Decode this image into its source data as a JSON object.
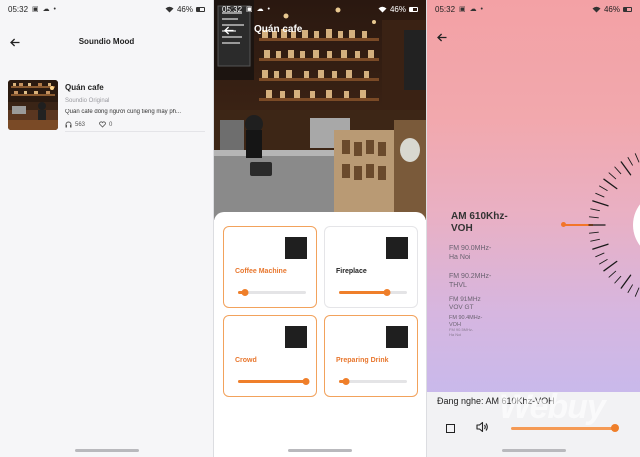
{
  "status_bar": {
    "time": "05:32",
    "left_icons": "▣ ☁ •",
    "battery": "46%"
  },
  "screen_list": {
    "title": "Soundio Mood",
    "item": {
      "title": "Quán cafe",
      "subtitle": "Soundio Original",
      "description": "Quán cafe đông người cùng tiếng máy ph...",
      "plays": "563",
      "likes": "0"
    }
  },
  "screen_mixer": {
    "title": "Quán cafe",
    "sounds": [
      {
        "label": "Coffee Machine",
        "level": 0.1,
        "active": true
      },
      {
        "label": "Fireplace",
        "level": 0.7,
        "active": false
      },
      {
        "label": "Crowd",
        "level": 1.0,
        "active": true
      },
      {
        "label": "Preparing Drink",
        "level": 0.1,
        "active": true
      }
    ]
  },
  "screen_radio": {
    "current_station": "AM 610Khz-\nVOH",
    "stations": [
      "FM  90.0MHz-\nHa Noi",
      "FM  90.2MHz-\nTHVL",
      "FM  91MHz\nVOV GT",
      "FM  90.4MHz-\nVOH",
      "FM  90.5MHz-\nHa Noi"
    ],
    "now_playing": "Đang nghe: AM 610Khz-VOH",
    "volume": 1.0,
    "watermark": "Webuy"
  },
  "colors": {
    "accent": "#ef7f2a",
    "accent_text": "#e8772e"
  }
}
